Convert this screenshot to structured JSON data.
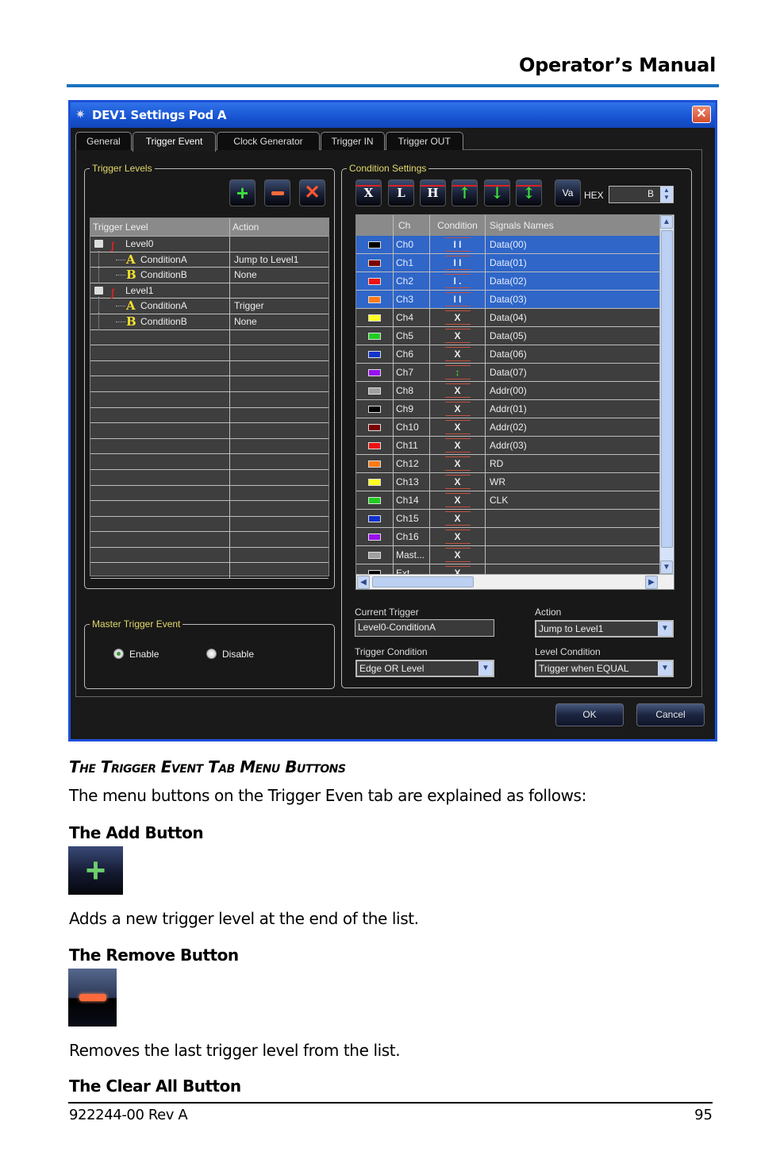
{
  "page": {
    "header": "Operator’s Manual",
    "footer_doc_id": "922244-00 Rev A",
    "page_number": "95"
  },
  "dialog": {
    "title": "DEV1 Settings Pod A",
    "title_icon": "gear-icon",
    "close_icon": "close-icon",
    "tabs": [
      {
        "label": "General",
        "active": false
      },
      {
        "label": "Trigger Event",
        "active": true
      },
      {
        "label": "Clock Generator",
        "active": false
      },
      {
        "label": "Trigger IN",
        "active": false
      },
      {
        "label": "Trigger OUT",
        "active": false
      }
    ],
    "trigger_levels": {
      "group_label": "Trigger Levels",
      "buttons": [
        {
          "name": "add",
          "icon": "plus-icon"
        },
        {
          "name": "remove",
          "icon": "minus-icon"
        },
        {
          "name": "clear-all",
          "icon": "x-icon"
        }
      ],
      "columns": [
        "Trigger Level",
        "Action"
      ],
      "rows": [
        {
          "type": "level",
          "label": "Level0",
          "action": ""
        },
        {
          "type": "condition",
          "letter": "A",
          "label": "ConditionA",
          "action": "Jump to Level1"
        },
        {
          "type": "condition",
          "letter": "B",
          "label": "ConditionB",
          "action": "None"
        },
        {
          "type": "level",
          "label": "Level1",
          "action": ""
        },
        {
          "type": "condition",
          "letter": "A",
          "label": "ConditionA",
          "action": "Trigger"
        },
        {
          "type": "condition",
          "letter": "B",
          "label": "ConditionB",
          "action": "None"
        }
      ],
      "empty_rows": 16
    },
    "condition_settings": {
      "group_label": "Condition Settings",
      "buttons": [
        {
          "label": "X",
          "name": "dont-care"
        },
        {
          "label": "L",
          "name": "low"
        },
        {
          "label": "H",
          "name": "high"
        },
        {
          "label": "↑",
          "name": "rising-edge"
        },
        {
          "label": "↓",
          "name": "falling-edge"
        },
        {
          "label": "↕",
          "name": "either-edge"
        },
        {
          "label": "Va",
          "name": "value"
        }
      ],
      "hex_label": "HEX",
      "hex_value": "B",
      "columns": [
        "",
        "Ch",
        "Condition",
        "Signals Names"
      ],
      "rows": [
        {
          "color": "#000000",
          "ch": "Ch0",
          "cond": "I I",
          "signal": "Data(00)",
          "selected": true
        },
        {
          "color": "#7a0000",
          "ch": "Ch1",
          "cond": "I I",
          "signal": "Data(01)",
          "selected": true
        },
        {
          "color": "#ee1111",
          "ch": "Ch2",
          "cond": "I .",
          "signal": "Data(02)",
          "selected": true
        },
        {
          "color": "#ff7a1a",
          "ch": "Ch3",
          "cond": "I I",
          "signal": "Data(03)",
          "selected": true
        },
        {
          "color": "#ffff22",
          "ch": "Ch4",
          "cond": "X",
          "signal": "Data(04)",
          "selected": false
        },
        {
          "color": "#22cc22",
          "ch": "Ch5",
          "cond": "X",
          "signal": "Data(05)",
          "selected": false
        },
        {
          "color": "#1133cc",
          "ch": "Ch6",
          "cond": "X",
          "signal": "Data(06)",
          "selected": false
        },
        {
          "color": "#9911ee",
          "ch": "Ch7",
          "cond": "↕",
          "signal": "Data(07)",
          "selected": false
        },
        {
          "color": "#a0a0a0",
          "ch": "Ch8",
          "cond": "X",
          "signal": "Addr(00)",
          "selected": false
        },
        {
          "color": "#000000",
          "ch": "Ch9",
          "cond": "X",
          "signal": "Addr(01)",
          "selected": false
        },
        {
          "color": "#7a0000",
          "ch": "Ch10",
          "cond": "X",
          "signal": "Addr(02)",
          "selected": false
        },
        {
          "color": "#ee1111",
          "ch": "Ch11",
          "cond": "X",
          "signal": "Addr(03)",
          "selected": false
        },
        {
          "color": "#ff7a1a",
          "ch": "Ch12",
          "cond": "X",
          "signal": "RD",
          "selected": false
        },
        {
          "color": "#ffff22",
          "ch": "Ch13",
          "cond": "X",
          "signal": "WR",
          "selected": false
        },
        {
          "color": "#22cc22",
          "ch": "Ch14",
          "cond": "X",
          "signal": "CLK",
          "selected": false
        },
        {
          "color": "#1133cc",
          "ch": "Ch15",
          "cond": "X",
          "signal": "",
          "selected": false
        },
        {
          "color": "#9911ee",
          "ch": "Ch16",
          "cond": "X",
          "signal": "",
          "selected": false
        },
        {
          "color": "#a0a0a0",
          "ch": "Mast...",
          "cond": "X",
          "signal": "",
          "selected": false
        },
        {
          "color": "#000000",
          "ch": "Ext",
          "cond": "X",
          "signal": "",
          "selected": false
        }
      ],
      "current_trigger_label": "Current Trigger",
      "current_trigger_value": "Level0-ConditionA",
      "action_label": "Action",
      "action_value": "Jump to Level1",
      "trigger_condition_label": "Trigger Condition",
      "trigger_condition_value": "Edge OR Level",
      "level_condition_label": "Level Condition",
      "level_condition_value": "Trigger when EQUAL"
    },
    "master_trigger": {
      "group_label": "Master Trigger Event",
      "enable_label": "Enable",
      "disable_label": "Disable",
      "selected": "Enable"
    },
    "ok_label": "OK",
    "cancel_label": "Cancel"
  },
  "doc": {
    "section_heading": "The Trigger Event Tab Menu Buttons",
    "intro": "The menu buttons on the Trigger Even tab are explained as follows:",
    "add_heading": "The Add Button",
    "add_desc": "Adds a new trigger level at the end of the list.",
    "remove_heading": "The Remove Button",
    "remove_desc": "Removes the last trigger level from the list.",
    "clear_heading": "The Clear All Button"
  }
}
